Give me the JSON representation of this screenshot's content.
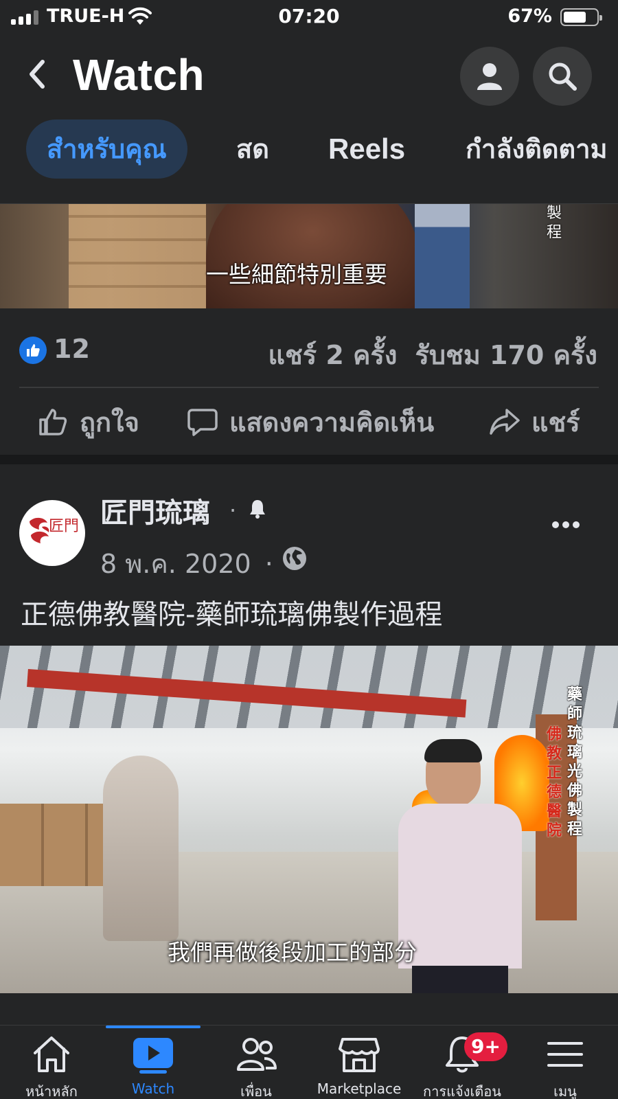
{
  "status_bar": {
    "carrier": "TRUE-H",
    "time": "07:20",
    "battery_percent": "67%",
    "battery_level": 0.67,
    "signal_bars": 3
  },
  "header": {
    "title": "Watch",
    "back_icon": "chevron-left-icon",
    "profile_icon": "person-icon",
    "search_icon": "search-icon"
  },
  "tabs": [
    {
      "label": "สำหรับคุณ",
      "active": true
    },
    {
      "label": "สด",
      "active": false
    },
    {
      "label": "Reels",
      "active": false
    },
    {
      "label": "กำลังติดตาม",
      "active": false
    }
  ],
  "video1": {
    "subtitle": "一些細節特別重要",
    "side_text": "製程"
  },
  "stats": {
    "likes": "12",
    "shares": "แชร์ 2 ครั้ง",
    "views": "รับชม 170 ครั้ง"
  },
  "actions": {
    "like": "ถูกใจ",
    "comment": "แสดงความคิดเห็น",
    "share": "แชร์"
  },
  "post": {
    "page_name": "匠門琉璃",
    "separator": "·",
    "date": "8 พ.ค. 2020",
    "caption": "正德佛教醫院-藥師琉璃佛製作過程",
    "avatar_logo": "匠門"
  },
  "video2": {
    "subtitle": "我們再做後段加工的部分",
    "side_text_red": "佛教正德醫院",
    "side_text_white": "藥師琉璃光佛製程"
  },
  "bottom_nav": [
    {
      "label": "หน้าหลัก",
      "icon": "home-icon",
      "active": false
    },
    {
      "label": "Watch",
      "icon": "video-play-icon",
      "active": true
    },
    {
      "label": "เพื่อน",
      "icon": "friends-icon",
      "active": false
    },
    {
      "label": "Marketplace",
      "icon": "marketplace-icon",
      "active": false
    },
    {
      "label": "การแจ้งเตือน",
      "icon": "bell-icon",
      "active": false,
      "badge": "9+"
    },
    {
      "label": "เมนู",
      "icon": "menu-icon",
      "active": false
    }
  ],
  "colors": {
    "background": "#242526",
    "accent": "#2d88ff",
    "badge": "#e41e3f",
    "secondary_text": "#b0b3b8"
  }
}
